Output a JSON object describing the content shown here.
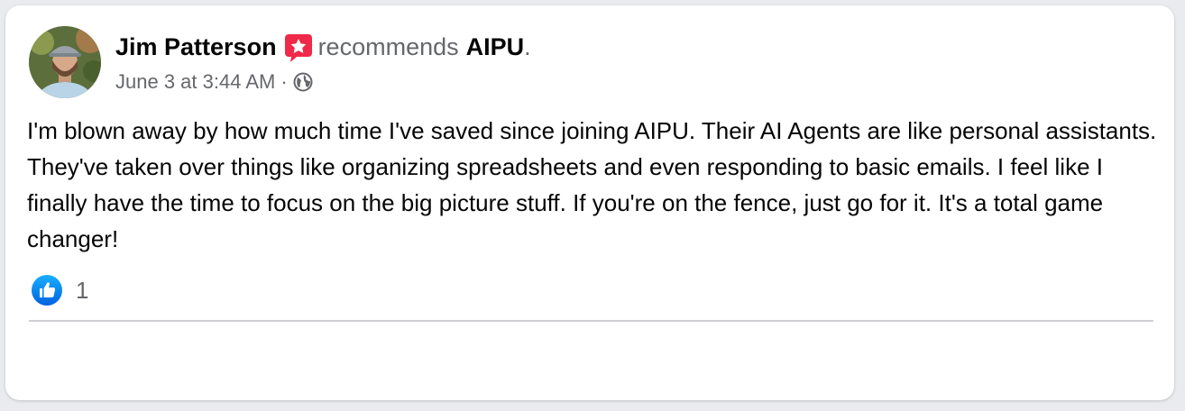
{
  "post": {
    "author": "Jim Patterson",
    "action": "recommends",
    "page_name": "AIPU",
    "period": ".",
    "timestamp": "June 3 at 3:44 AM",
    "separator": "·",
    "audience_icon": "globe-icon",
    "recommend_icon": "recommend-star-icon",
    "paragraphs": [
      "I'm blown away by how much time I've saved since joining AIPU. Their AI Agents are like personal assistants. They've taken over things like organizing spreadsheets and even responding to basic emails. I feel like I finally have the time to focus on the big picture stuff. If you're on the fence, just go for it. It's a total game changer!"
    ]
  },
  "reactions": {
    "icon": "like-icon",
    "count": "1"
  },
  "colors": {
    "like_blue": "#1877f2",
    "recommend_red": "#f02849",
    "secondary_text": "#65676b",
    "primary_text": "#050505"
  }
}
